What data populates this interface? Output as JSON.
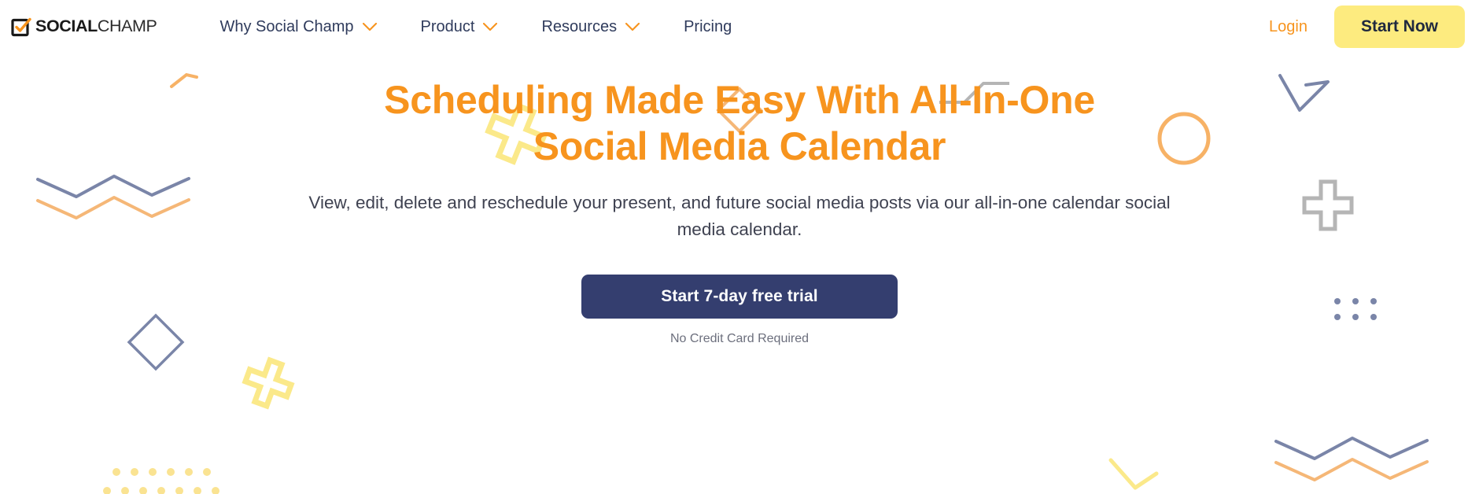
{
  "brand": {
    "logo_bold": "SOCIAL",
    "logo_light": "CHAMP",
    "logo_icon": "checkbox-check-icon",
    "accent_orange": "#f7941e",
    "accent_yellow": "#fdeb7f",
    "accent_navy": "#343e6f",
    "nav_text_color": "#2f3b5c",
    "slate_blue": "#7a85a8",
    "grey": "#b5b5b5"
  },
  "header": {
    "nav_items": [
      {
        "label": "Why Social Champ",
        "has_dropdown": true,
        "icon": "chevron-down-icon"
      },
      {
        "label": "Product",
        "has_dropdown": true,
        "icon": "chevron-down-icon"
      },
      {
        "label": "Resources",
        "has_dropdown": true,
        "icon": "chevron-down-icon"
      },
      {
        "label": "Pricing",
        "has_dropdown": false,
        "icon": ""
      }
    ],
    "login_label": "Login",
    "start_now_label": "Start Now"
  },
  "hero": {
    "headline_line1": "Scheduling Made Easy With All-In-One",
    "headline_line2": "Social Media Calendar",
    "subheadline": "View, edit, delete and reschedule your present, and future social media posts via our all-in-one calendar social media calendar.",
    "cta_label": "Start 7-day free trial",
    "cta_note": "No Credit Card Required"
  },
  "decorations": [
    {
      "name": "orange-short-line",
      "type": "line",
      "color": "#f7b266"
    },
    {
      "name": "yellow-plus-large",
      "type": "plus-outline",
      "color": "#fbe98a"
    },
    {
      "name": "orange-diamond-small",
      "type": "diamond-outline",
      "color": "#f5b777"
    },
    {
      "name": "grey-step-line",
      "type": "step-line",
      "color": "#b5b5b5"
    },
    {
      "name": "navy-check-shape",
      "type": "check",
      "color": "#7a85a8"
    },
    {
      "name": "orange-circle-outline",
      "type": "circle-outline",
      "color": "#f7b266"
    },
    {
      "name": "slate-zigzag",
      "type": "zigzag",
      "color": "#7a85a8"
    },
    {
      "name": "orange-zigzag",
      "type": "zigzag",
      "color": "#f5b777"
    },
    {
      "name": "grey-plus-outline",
      "type": "plus-outline",
      "color": "#b5b5b5"
    },
    {
      "name": "slate-dot-grid",
      "type": "dot-grid",
      "color": "#7a85a8"
    },
    {
      "name": "slate-diamond-outline",
      "type": "diamond-outline",
      "color": "#7a85a8"
    },
    {
      "name": "yellow-plus-small",
      "type": "plus-outline",
      "color": "#fbe98a"
    },
    {
      "name": "yellow-dot-grid",
      "type": "dot-grid",
      "color": "#fae392"
    },
    {
      "name": "slate-zigzag-right",
      "type": "zigzag",
      "color": "#7a85a8"
    },
    {
      "name": "orange-zigzag-right",
      "type": "zigzag",
      "color": "#f5b777"
    },
    {
      "name": "yellow-angle-line",
      "type": "line",
      "color": "#fbe98a"
    }
  ]
}
